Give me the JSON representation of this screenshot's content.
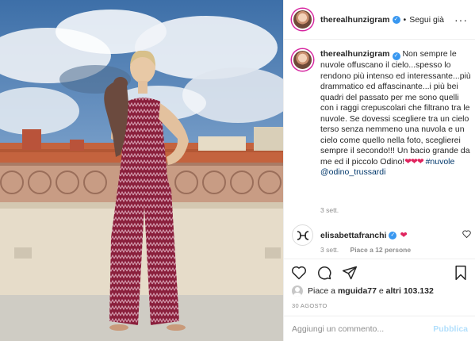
{
  "header": {
    "username": "therealhunzigram",
    "separator": "•",
    "follow_label": "Segui già",
    "more_label": "···"
  },
  "caption": {
    "username": "therealhunzigram",
    "text": "Non sempre le nuvole offuscano il cielo...spesso lo rendono più intenso ed interessante...più drammatico ed affascinante...i più bei quadri del passato per me sono quelli con i raggi crepuscolari che filtrano tra le nuvole. Se dovessi scegliere tra un cielo terso senza nemmeno una nuvola e un cielo come quello nella foto, sceglierei sempre il secondo!!! Un bacio grande da me ed il piccolo Odino!",
    "hearts": "❤❤❤",
    "hashtag": "#nuvole",
    "mention": "@odino_trussardi",
    "time": "3 sett."
  },
  "comment": {
    "username": "elisabettafranchi",
    "reaction": "❤",
    "time": "3 sett.",
    "likes": "Piace a 12 persone",
    "like_icon": "heart-outline-icon"
  },
  "actions": {
    "icons": [
      "heart-outline-icon",
      "comment-icon",
      "share-icon",
      "bookmark-icon"
    ]
  },
  "likes": {
    "prefix": "Piace a ",
    "user": "mguida77",
    "middle": " e ",
    "others": "altri 103.132"
  },
  "date": "30 AGOSTO",
  "add_comment": {
    "placeholder": "Aggiungi un commento...",
    "publish_label": "Pubblica"
  },
  "colors": {
    "verified": "#3897f0",
    "link": "#00376b",
    "heart": "#e0245e",
    "publish_disabled": "#b2dffc",
    "muted": "#8e8e8e"
  }
}
